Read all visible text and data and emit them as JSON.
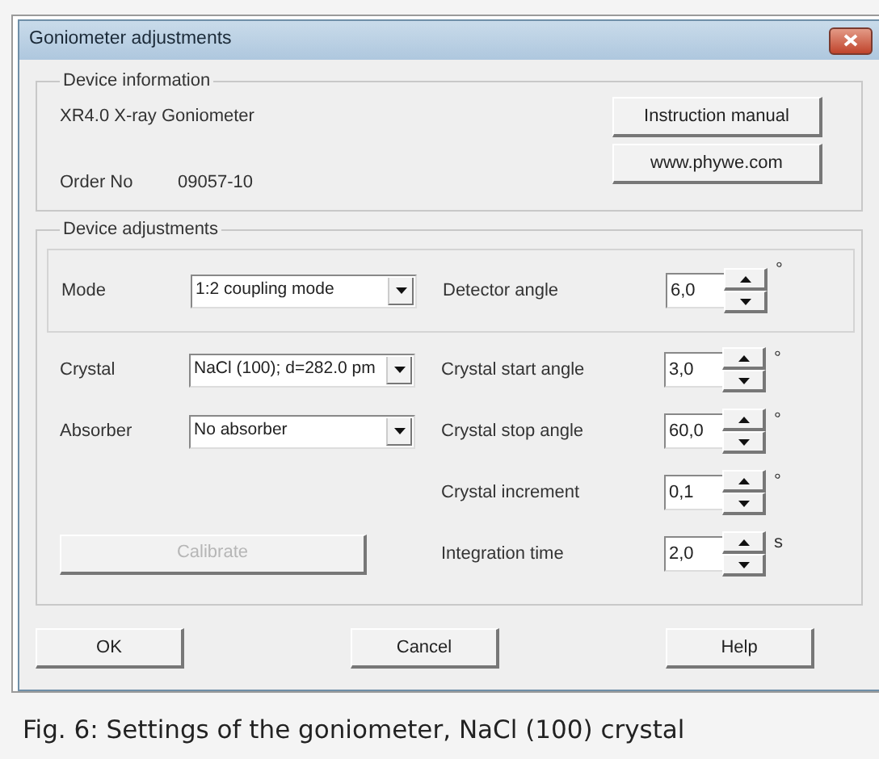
{
  "window": {
    "title": "Goniometer adjustments"
  },
  "device_information": {
    "title": "Device information",
    "device": "XR4.0 X-ray Goniometer",
    "order_label": "Order No",
    "order_number": "09057-10",
    "buttons": [
      "Instruction manual",
      "www.phywe.com"
    ]
  },
  "device_adjustments": {
    "title": "Device adjustments",
    "mode": {
      "label": "Mode",
      "value": "1:2 coupling mode"
    },
    "selects": [
      {
        "label": "Crystal",
        "value": "NaCl (100); d=282.0 pm"
      },
      {
        "label": "Absorber",
        "value": "No absorber"
      }
    ],
    "calibrate": {
      "label": "Calibrate",
      "disabled": true
    },
    "spinners": [
      {
        "label": "Detector angle",
        "value": "6,0",
        "unit": "°"
      },
      {
        "label": "Crystal start angle",
        "value": "3,0",
        "unit": "°"
      },
      {
        "label": "Crystal stop angle",
        "value": "60,0",
        "unit": "°"
      },
      {
        "label": "Crystal increment",
        "value": "0,1",
        "unit": "°"
      },
      {
        "label": "Integration time",
        "value": "2,0",
        "unit": "s"
      }
    ]
  },
  "buttons": [
    "OK",
    "Cancel",
    "Help"
  ],
  "caption": "Fig. 6: Settings of the goniometer, NaCl (100) crystal"
}
